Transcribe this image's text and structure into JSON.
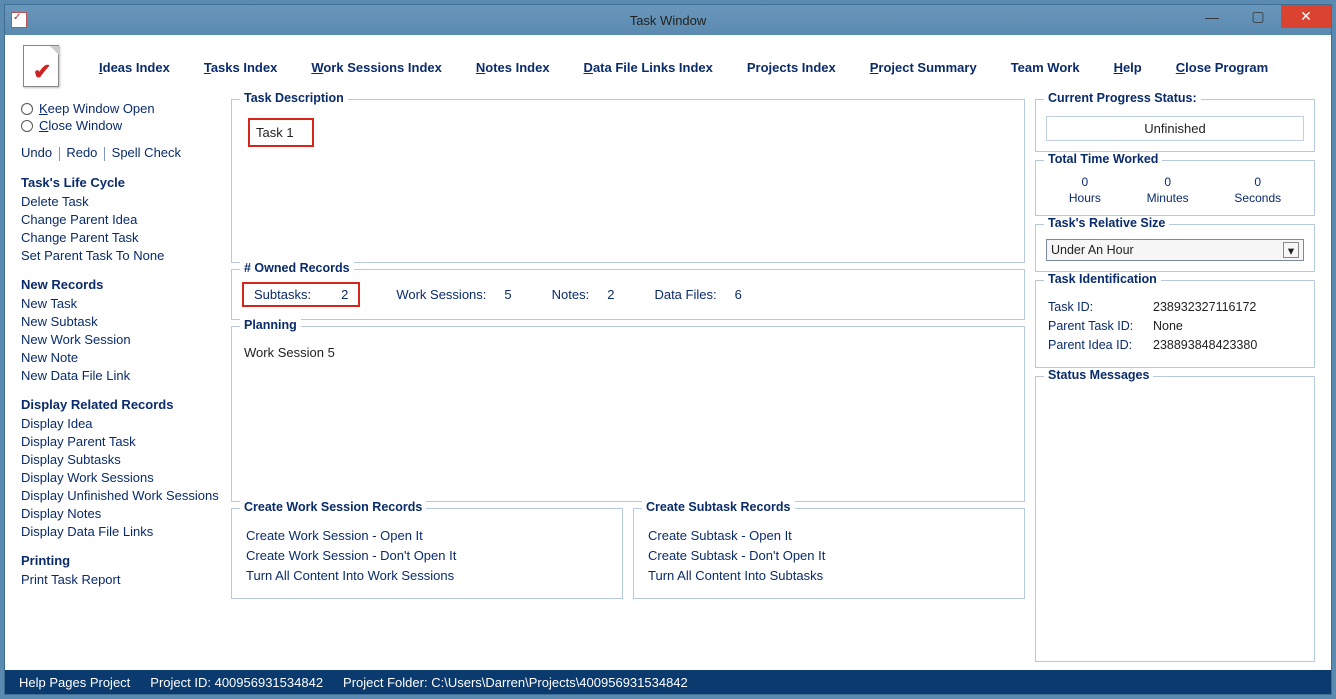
{
  "window": {
    "title": "Task Window"
  },
  "nav": {
    "ideas": "Ideas Index",
    "tasks": "Tasks Index",
    "work_sessions": "Work Sessions Index",
    "notes": "Notes Index",
    "data_files": "Data File Links Index",
    "projects": "Projects Index",
    "summary": "Project Summary",
    "team": "Team Work",
    "help": "Help",
    "close": "Close Program"
  },
  "left": {
    "keep_open": "Keep Window Open",
    "close_win": "Close Window",
    "undo": "Undo",
    "redo": "Redo",
    "spell": "Spell Check",
    "life_cycle_title": "Task's Life Cycle",
    "delete": "Delete Task",
    "change_parent_idea": "Change Parent Idea",
    "change_parent_task": "Change Parent Task",
    "set_parent_none": "Set Parent Task To None",
    "new_records_title": "New Records",
    "new_task": "New Task",
    "new_subtask": "New Subtask",
    "new_ws": "New Work Session",
    "new_note": "New Note",
    "new_dfl": "New Data File Link",
    "display_title": "Display Related Records",
    "display_idea": "Display Idea",
    "display_parent_task": "Display Parent Task",
    "display_subtasks": "Display Subtasks",
    "display_ws": "Display Work Sessions",
    "display_unfinished_ws": "Display Unfinished Work Sessions",
    "display_notes": "Display Notes",
    "display_dfl": "Display Data File Links",
    "printing_title": "Printing",
    "print_report": "Print Task Report"
  },
  "center": {
    "desc_legend": "Task Description",
    "desc_value": "Task 1",
    "owned_legend": "# Owned Records",
    "subtasks_label": "Subtasks:",
    "subtasks_value": "2",
    "ws_label": "Work Sessions:",
    "ws_value": "5",
    "notes_label": "Notes:",
    "notes_value": "2",
    "df_label": "Data Files:",
    "df_value": "6",
    "planning_legend": "Planning",
    "planning_value": "Work Session 5",
    "cws_legend": "Create Work Session Records",
    "cws_open": "Create Work Session - Open It",
    "cws_noop": "Create Work Session - Don't Open It",
    "cws_turn": "Turn All Content Into Work Sessions",
    "cst_legend": "Create Subtask Records",
    "cst_open": "Create Subtask - Open It",
    "cst_noop": "Create Subtask - Don't Open It",
    "cst_turn": "Turn All Content Into Subtasks"
  },
  "right": {
    "status_legend": "Current Progress Status:",
    "status_value": "Unfinished",
    "time_legend": "Total Time Worked",
    "hours": "0",
    "hours_label": "Hours",
    "minutes": "0",
    "minutes_label": "Minutes",
    "seconds": "0",
    "seconds_label": "Seconds",
    "size_legend": "Task's Relative Size",
    "size_value": "Under An Hour",
    "ident_legend": "Task Identification",
    "task_id_label": "Task ID:",
    "task_id_value": "238932327116172",
    "parent_task_label": "Parent Task ID:",
    "parent_task_value": "None",
    "parent_idea_label": "Parent Idea ID:",
    "parent_idea_value": "238893848423380",
    "msgs_legend": "Status Messages"
  },
  "status": {
    "help": "Help Pages Project",
    "proj_id_label": "Project ID:",
    "proj_id": "400956931534842",
    "folder_label": "Project Folder:",
    "folder": "C:\\Users\\Darren\\Projects\\400956931534842"
  }
}
